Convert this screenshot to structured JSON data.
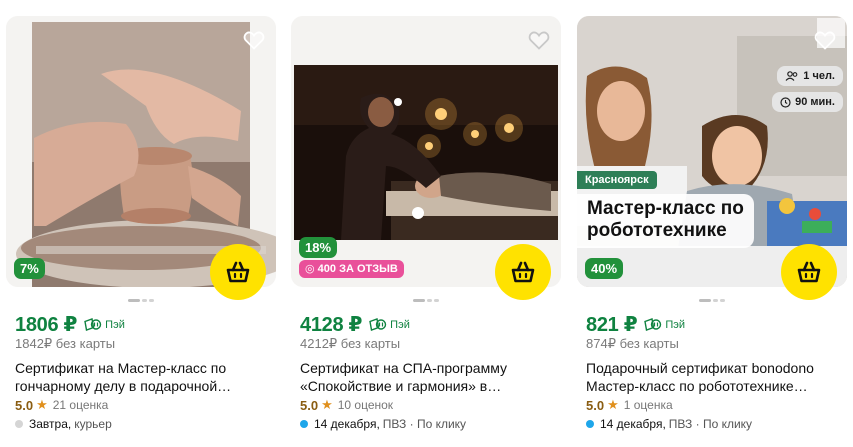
{
  "colors": {
    "price_green": "#0f8240",
    "cart_yellow": "#ffe200",
    "discount_green": "#22913b",
    "promo_pink": "#e9509a",
    "delivery_blue": "#1ea6ea",
    "delivery_gray": "#d5d5d5"
  },
  "cards": [
    {
      "discount": "7%",
      "price": "1806 ₽",
      "pay_label": "Пэй",
      "old_price": "1842₽ без карты",
      "title_line1": "Сертификат на Мастер-класс по",
      "title_line2": "гончарному делу в подарочной…",
      "rating_score": "5.0",
      "rating_star": "★",
      "rating_count": "21 оценка",
      "delivery_date": "Завтра,",
      "delivery_rest": "курьер",
      "delivery_dot_color": "gray",
      "image_icon": "pottery-photo"
    },
    {
      "discount": "18%",
      "promo": "◎ 400 ЗА ОТЗЫВ",
      "price": "4128 ₽",
      "pay_label": "Пэй",
      "old_price": "4212₽ без карты",
      "title_line1": "Сертификат на СПА-программу",
      "title_line2": "«Спокойствие и гармония» в…",
      "rating_score": "5.0",
      "rating_star": "★",
      "rating_count": "10 оценок",
      "delivery_date": "14 декабря,",
      "delivery_rest": "ПВЗ · По клику",
      "delivery_dot_color": "blue",
      "image_icon": "spa-massage-photo"
    },
    {
      "discount": "40%",
      "price": "821 ₽",
      "pay_label": "Пэй",
      "old_price": "874₽ без карты",
      "title_line1": "Подарочный сертификат bonodono",
      "title_line2": "Мастер-класс по робототехнике…",
      "rating_score": "5.0",
      "rating_star": "★",
      "rating_count": "1 оценка",
      "delivery_date": "14 декабря,",
      "delivery_rest": "ПВЗ · По клику",
      "delivery_dot_color": "blue",
      "image_icon": "robotics-kids-photo",
      "img_city": "Красноярск",
      "img_title_line1": "Мастер-класс по",
      "img_title_line2": "робототехнике",
      "img_people": "1 чел.",
      "img_duration": "90 мин."
    }
  ]
}
